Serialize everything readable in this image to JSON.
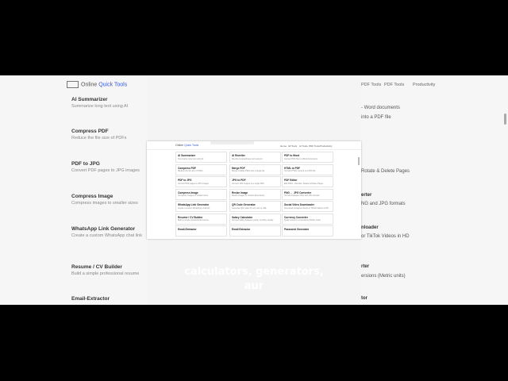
{
  "background": {
    "logo": {
      "text": "Online",
      "accent": "Quick Tools"
    },
    "nav": [
      "PDF Tools",
      "PDF Tools",
      "Productivity"
    ],
    "tools": [
      {
        "title": "AI Summarizer",
        "desc": "Summarize long text using AI"
      },
      {
        "title": "Compress PDF",
        "desc": "Reduce the file size of PDFs"
      },
      {
        "title": "PDF to JPG",
        "desc": "Convert PDF pages to JPG images"
      },
      {
        "title": "Compress Image",
        "desc": "Compress images to smaller sizes"
      },
      {
        "title": "WhatsApp Link Generator",
        "desc": "Create a custom WhatsApp chat link"
      },
      {
        "title": "Resume / CV Builder",
        "desc": "Build a simple professional resume"
      },
      {
        "title": "Email-Extractor",
        "desc": ""
      }
    ],
    "right_snippets": [
      {
        "text": "- Word documents",
        "bold": false
      },
      {
        "text": "into a PDF file",
        "bold": false
      },
      {
        "text": "Rotate & Delete Pages",
        "bold": false
      },
      {
        "text": "erter",
        "bold": true
      },
      {
        "text": "NG and JPG formats",
        "bold": false
      },
      {
        "text": "nloader",
        "bold": true
      },
      {
        "text": "or TikTok Videos in HD",
        "bold": false
      },
      {
        "text": "rter",
        "bold": true
      },
      {
        "text": "ersions (Metric units)",
        "bold": false
      },
      {
        "text": "tor",
        "bold": true
      }
    ]
  },
  "window": {
    "logo": {
      "text": "Online",
      "accent": "Quick Tools"
    },
    "nav": [
      "Home",
      "All Tools",
      "AI Tools",
      "PDF Tools",
      "Productivity"
    ],
    "cards": [
      [
        {
          "title": "AI Summarizer",
          "desc": "Summarize long text using AI"
        },
        {
          "title": "AI Rewriter",
          "desc": "Rewrite & paraphrase text using AI"
        },
        {
          "title": "PDF to Word",
          "desc": "Convert PDF files to Word documents"
        }
      ],
      [
        {
          "title": "Compress PDF",
          "desc": "Reduce the file size of PDFs"
        },
        {
          "title": "Merge PDF",
          "desc": "Merge multiple PDFs into a single file"
        },
        {
          "title": "HTML to PDF",
          "desc": "Convert HTML content to a PDF file"
        }
      ],
      [
        {
          "title": "PDF to JPG",
          "desc": "Convert PDF pages to JPG images"
        },
        {
          "title": "JPG to PDF",
          "desc": "Convert JPG images to a single PDF"
        },
        {
          "title": "PDF Editor",
          "desc": "Edit PDFs - Reorder, Rotate & Delete Pages"
        }
      ],
      [
        {
          "title": "Compress Image",
          "desc": "Compress images to smaller sizes"
        },
        {
          "title": "Resize Image",
          "desc": "Resize images to custom dimensions"
        },
        {
          "title": "PNG ↔ JPG Converter",
          "desc": "Convert between PNG and JPG formats"
        }
      ],
      [
        {
          "title": "WhatsApp Link Generator",
          "desc": "Create a custom WhatsApp chat link"
        },
        {
          "title": "QR Code Generator",
          "desc": "Generate QR codes for any text or URL"
        },
        {
          "title": "Social Video Downloader",
          "desc": "Download Instagram Reels or TikTok Videos in HD"
        }
      ],
      [
        {
          "title": "Resume / CV Builder",
          "desc": "Build a simple professional resume"
        },
        {
          "title": "Salary Calculator",
          "desc": "Convert salary between yearly, monthly, weekly"
        },
        {
          "title": "Currency Converter",
          "desc": "Quick currency conversions (Metric units)"
        }
      ],
      [
        {
          "title": "Email-Extractor",
          "desc": ""
        },
        {
          "title": "Email Extractor",
          "desc": ""
        },
        {
          "title": "Password Generator",
          "desc": ""
        }
      ]
    ]
  },
  "caption": {
    "line1": "calculators, generators,",
    "line2": "aur"
  }
}
